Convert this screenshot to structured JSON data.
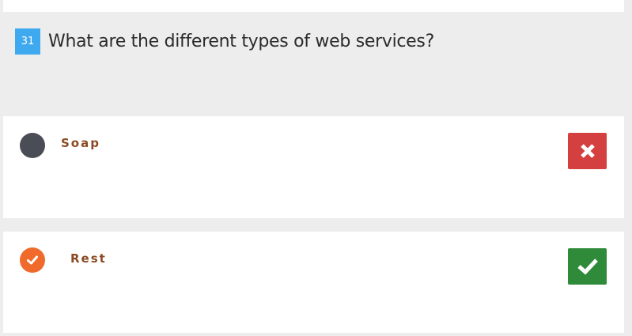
{
  "question": {
    "number": "31",
    "text": "What are the different types of web services?"
  },
  "options": [
    {
      "label": "Soap",
      "selected": false,
      "result": "incorrect",
      "result_icon": "x-mark-icon",
      "result_color": "#d43f3f"
    },
    {
      "label": "Rest",
      "selected": true,
      "result": "correct",
      "result_icon": "check-mark-icon",
      "result_color": "#2f8a3a"
    }
  ],
  "colors": {
    "question_badge": "#3fa9f0",
    "selected_radio": "#ef6a2b",
    "unselected_radio": "#4a4d55",
    "option_label": "#8a4a23"
  }
}
